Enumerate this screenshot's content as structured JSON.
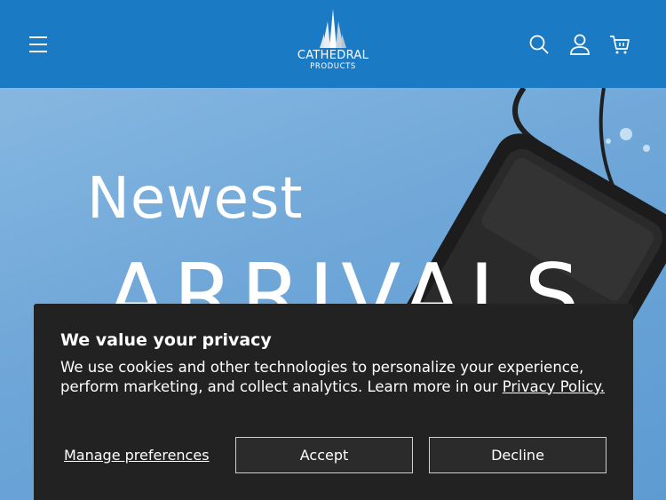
{
  "header": {
    "brand_name": "CATHEDRAL",
    "brand_sub": "PRODUCTS",
    "icons": [
      "menu-icon",
      "search-icon",
      "account-icon",
      "cart-icon"
    ],
    "background_color": "#1a7ac4"
  },
  "hero": {
    "line1": "Newest",
    "line2": "ARRIVALS"
  },
  "cookie_banner": {
    "title": "We value your privacy",
    "body": "We use cookies and other technologies to personalize your experience, perform marketing, and collect analytics. Learn more in our ",
    "policy_link": "Privacy Policy.",
    "manage_label": "Manage preferences",
    "accept_label": "Accept",
    "decline_label": "Decline",
    "background_color": "#222222"
  }
}
